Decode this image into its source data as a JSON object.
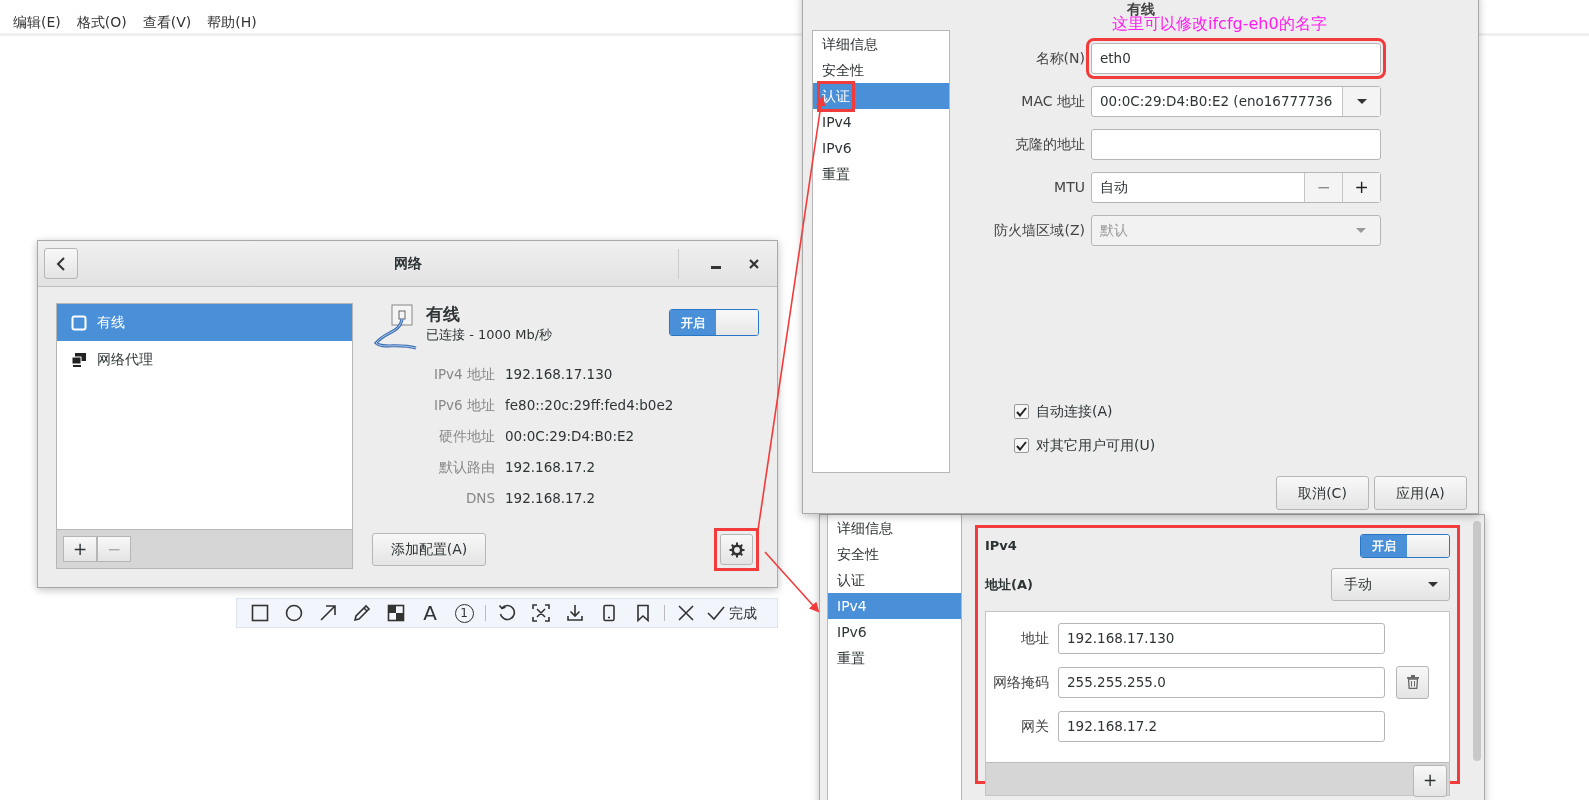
{
  "menu_bar": [
    {
      "label": "编辑(E)"
    },
    {
      "label": "格式(O)"
    },
    {
      "label": "查看(V)"
    },
    {
      "label": "帮助(H)"
    }
  ],
  "network_window": {
    "title": "网络",
    "sidebar": [
      {
        "label": "有线",
        "kind": "wired",
        "selected": true
      },
      {
        "label": "网络代理",
        "kind": "proxy",
        "selected": false
      }
    ],
    "list_buttons": [
      {
        "label": "+",
        "disabled": false
      },
      {
        "label": "−",
        "disabled": true
      }
    ],
    "connection": {
      "name": "有线",
      "status": "已连接 - 1000 Mb/秒",
      "switch": {
        "label": "开启",
        "on": true
      }
    },
    "details": [
      {
        "label": "IPv4 地址",
        "value": "192.168.17.130"
      },
      {
        "label": "IPv6 地址",
        "value": "fe80::20c:29ff:fed4:b0e2"
      },
      {
        "label": "硬件地址",
        "value": "00:0C:29:D4:B0:E2"
      },
      {
        "label": "默认路由",
        "value": "192.168.17.2"
      },
      {
        "label": "DNS",
        "value": "192.168.17.2"
      }
    ],
    "add_button": "添加配置(A)",
    "settings_highlighted": true
  },
  "settings_dialog": {
    "title": "有线",
    "note": "这里可以修改ifcfg-eh0的名字",
    "sidebar": [
      {
        "label": "详细信息",
        "selected": false,
        "highlighted": false
      },
      {
        "label": "安全性",
        "selected": false,
        "highlighted": false
      },
      {
        "label": "认证",
        "selected": true,
        "highlighted": true
      },
      {
        "label": "IPv4",
        "selected": false,
        "highlighted": false
      },
      {
        "label": "IPv6",
        "selected": false,
        "highlighted": false
      },
      {
        "label": "重置",
        "selected": false,
        "highlighted": false
      }
    ],
    "fields": [
      {
        "kind": "text",
        "label": "名称(N)",
        "value": "eth0",
        "highlighted": true
      },
      {
        "kind": "combo",
        "label": "MAC 地址",
        "value": "00:0C:29:D4:B0:E2 (eno16777736",
        "disabled": false
      },
      {
        "kind": "text",
        "label": "克隆的地址",
        "highlighted": false
      },
      {
        "kind": "spin",
        "label": "MTU",
        "value": "自动",
        "minus": {
          "label": "−",
          "disabled": true
        },
        "plus": {
          "label": "+",
          "disabled": false
        }
      },
      {
        "kind": "combo",
        "label": "防火墙区域(Z)",
        "value": "默认",
        "disabled": true
      }
    ],
    "checkboxes": [
      {
        "label": "自动连接(A)",
        "checked": true
      },
      {
        "label": "对其它用户可用(U)",
        "checked": true
      }
    ],
    "buttons": [
      "取消(C)",
      "应用(A)"
    ]
  },
  "ipv4_dialog": {
    "sidebar": [
      {
        "label": "详细信息",
        "selected": false
      },
      {
        "label": "安全性",
        "selected": false
      },
      {
        "label": "认证",
        "selected": false
      },
      {
        "label": "IPv4",
        "selected": true
      },
      {
        "label": "IPv6",
        "selected": false
      },
      {
        "label": "重置",
        "selected": false
      }
    ],
    "section": {
      "title": "IPv4",
      "switch": {
        "label": "开启",
        "on": true
      },
      "highlighted": true,
      "address_label": "地址(A)",
      "method": "手动",
      "rows": [
        {
          "label": "地址",
          "value": "192.168.17.130",
          "deletable": false
        },
        {
          "label": "网络掩码",
          "value": "255.255.255.0",
          "deletable": true
        },
        {
          "label": "网关",
          "value": "192.168.17.2",
          "deletable": false
        }
      ],
      "add_button": "+"
    }
  },
  "screenshot_toolbar": {
    "text_tool": "A",
    "step_number": "1",
    "done": "完成"
  }
}
